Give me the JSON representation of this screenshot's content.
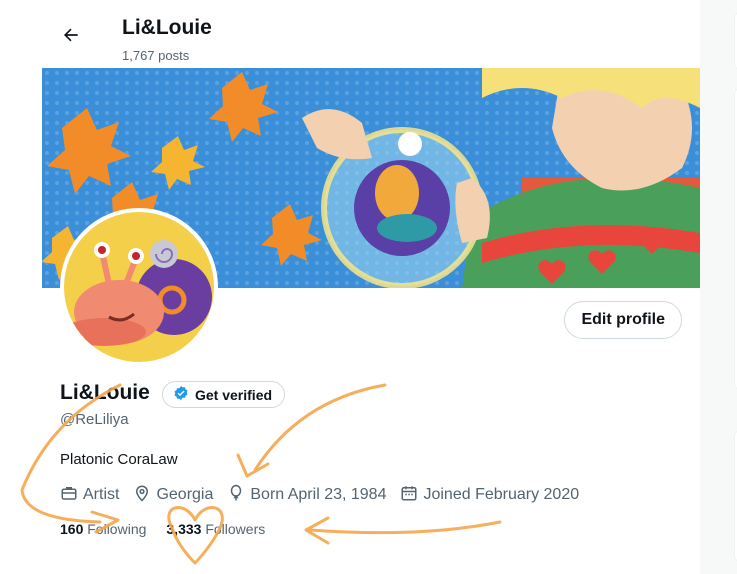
{
  "header": {
    "title": "Li&Louie",
    "post_count": "1,767 posts"
  },
  "profile": {
    "display_name": "Li&Louie",
    "get_verified_label": "Get verified",
    "handle": "@ReLiliya",
    "bio": "Platonic CoraLaw",
    "edit_profile_label": "Edit profile",
    "meta": {
      "category": "Artist",
      "location": "Georgia",
      "birthday": "Born April 23, 1984",
      "joined": "Joined February 2020"
    },
    "stats": {
      "following_count": "160",
      "following_label": "Following",
      "followers_count": "3,333",
      "followers_label": "Followers"
    }
  },
  "colors": {
    "accent": "#1d9bf0",
    "doodle": "#f5a64a",
    "text_secondary": "#536471"
  },
  "icons": [
    "back-arrow-icon",
    "verified-badge-icon",
    "briefcase-icon",
    "location-pin-icon",
    "balloon-icon",
    "calendar-icon"
  ]
}
